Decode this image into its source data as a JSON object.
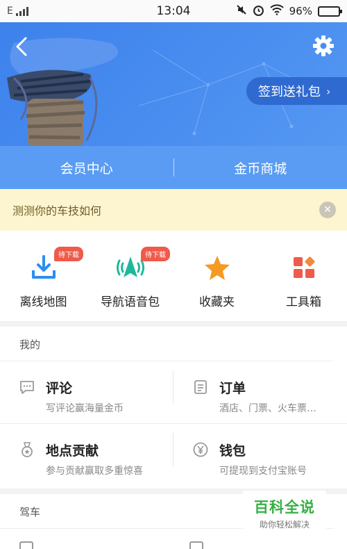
{
  "status_bar": {
    "carrier": "E",
    "time": "13:04",
    "battery": "96%",
    "battery_level": 0.96
  },
  "header": {
    "back_icon": "back-arrow-icon",
    "settings_icon": "gear-icon",
    "checkin_label": "签到送礼包"
  },
  "member_bar": {
    "tabs": [
      "会员中心",
      "金币商城"
    ]
  },
  "notice": {
    "text": "测测你的车技如何"
  },
  "tools": [
    {
      "label": "离线地图",
      "badge": "待下载",
      "icon": "download-icon",
      "color": "#2b8ff0"
    },
    {
      "label": "导航语音包",
      "badge": "待下载",
      "icon": "voice-navigation-icon",
      "color": "#1fb89a"
    },
    {
      "label": "收藏夹",
      "badge": "",
      "icon": "star-icon",
      "color": "#f59a23"
    },
    {
      "label": "工具箱",
      "badge": "",
      "icon": "toolbox-icon",
      "color": "#ef5a4a"
    }
  ],
  "my": {
    "title": "我的",
    "items": [
      {
        "title": "评论",
        "subtitle": "写评论赢海量金币",
        "icon": "comment-icon"
      },
      {
        "title": "订单",
        "subtitle": "酒店、门票、火车票…",
        "icon": "order-list-icon"
      },
      {
        "title": "地点贡献",
        "subtitle": "参与贡献赢取多重惊喜",
        "icon": "medal-icon"
      },
      {
        "title": "钱包",
        "subtitle": "可提现到支付宝账号",
        "icon": "yen-wallet-icon"
      }
    ]
  },
  "drive": {
    "title": "驾车"
  },
  "watermark": {
    "title": "百科全说",
    "subtitle": "助你轻松解决"
  }
}
